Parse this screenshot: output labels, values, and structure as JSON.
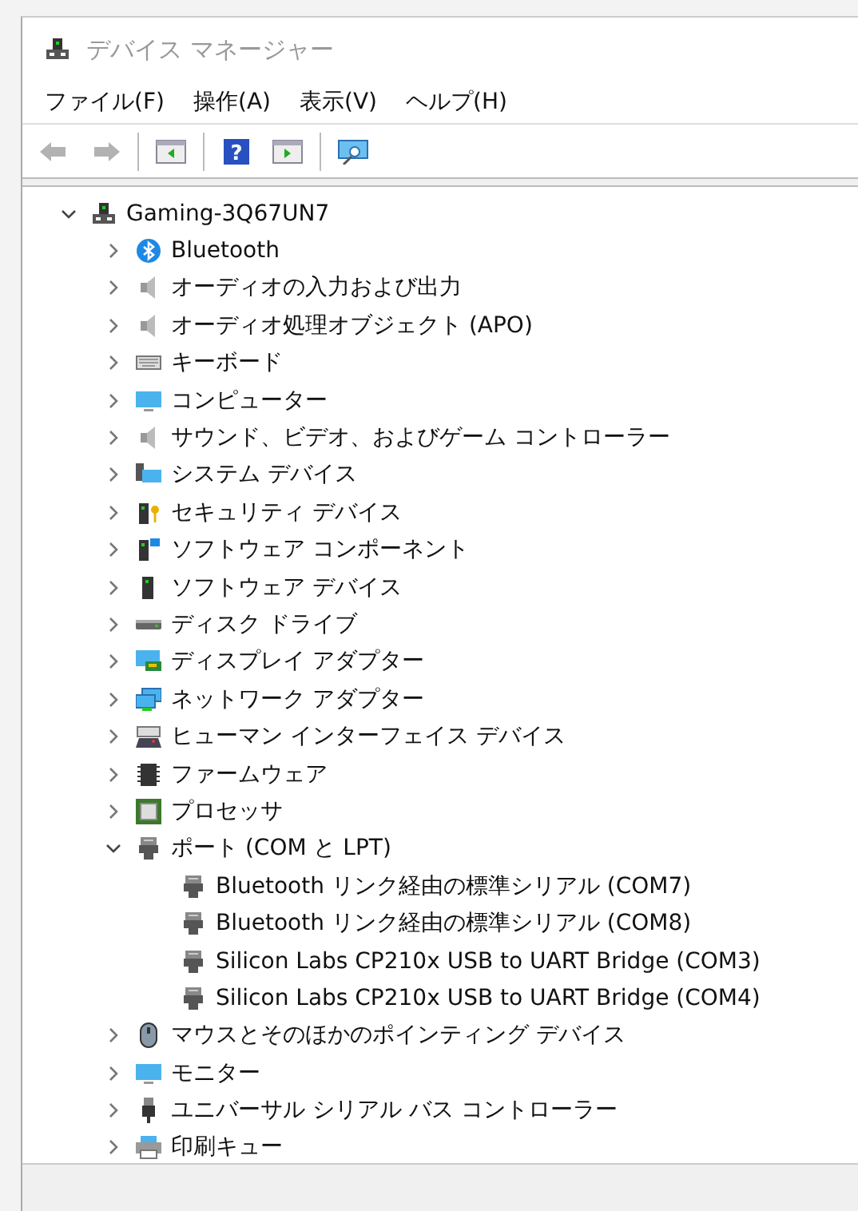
{
  "window": {
    "title": "デバイス マネージャー"
  },
  "menu": [
    "ファイル(F)",
    "操作(A)",
    "表示(V)",
    "ヘルプ(H)"
  ],
  "toolbar": [
    {
      "kind": "back",
      "disabled": true
    },
    {
      "kind": "forward",
      "disabled": true
    },
    {
      "kind": "separator"
    },
    {
      "kind": "console-tree",
      "disabled": false
    },
    {
      "kind": "separator"
    },
    {
      "kind": "help",
      "disabled": false,
      "glyph": "?"
    },
    {
      "kind": "action-pane",
      "disabled": false
    },
    {
      "kind": "separator"
    },
    {
      "kind": "scan",
      "disabled": false
    }
  ],
  "tree": {
    "label": "Gaming-3Q67UN7",
    "expanded": true,
    "children": [
      {
        "label": "Bluetooth",
        "expanded": false
      },
      {
        "label": "オーディオの入力および出力",
        "expanded": false
      },
      {
        "label": "オーディオ処理オブジェクト (APO)",
        "expanded": false
      },
      {
        "label": "キーボード",
        "expanded": false
      },
      {
        "label": "コンピューター",
        "expanded": false
      },
      {
        "label": "サウンド、ビデオ、およびゲーム コントローラー",
        "expanded": false
      },
      {
        "label": "システム デバイス",
        "expanded": false
      },
      {
        "label": "セキュリティ デバイス",
        "expanded": false
      },
      {
        "label": "ソフトウェア コンポーネント",
        "expanded": false
      },
      {
        "label": "ソフトウェア デバイス",
        "expanded": false
      },
      {
        "label": "ディスク ドライブ",
        "expanded": false
      },
      {
        "label": "ディスプレイ アダプター",
        "expanded": false
      },
      {
        "label": "ネットワーク アダプター",
        "expanded": false
      },
      {
        "label": "ヒューマン インターフェイス デバイス",
        "expanded": false
      },
      {
        "label": "ファームウェア",
        "expanded": false
      },
      {
        "label": "プロセッサ",
        "expanded": false
      },
      {
        "label": "ポート (COM と LPT)",
        "expanded": true,
        "children": [
          {
            "label": "Bluetooth リンク経由の標準シリアル (COM7)"
          },
          {
            "label": "Bluetooth リンク経由の標準シリアル (COM8)"
          },
          {
            "label": "Silicon Labs CP210x USB to UART Bridge (COM3)"
          },
          {
            "label": "Silicon Labs CP210x USB to UART Bridge (COM4)"
          }
        ]
      },
      {
        "label": "マウスとそのほかのポインティング デバイス",
        "expanded": false
      },
      {
        "label": "モニター",
        "expanded": false
      },
      {
        "label": "ユニバーサル シリアル バス コントローラー",
        "expanded": false
      },
      {
        "label": "印刷キュー",
        "expanded": false
      }
    ]
  }
}
